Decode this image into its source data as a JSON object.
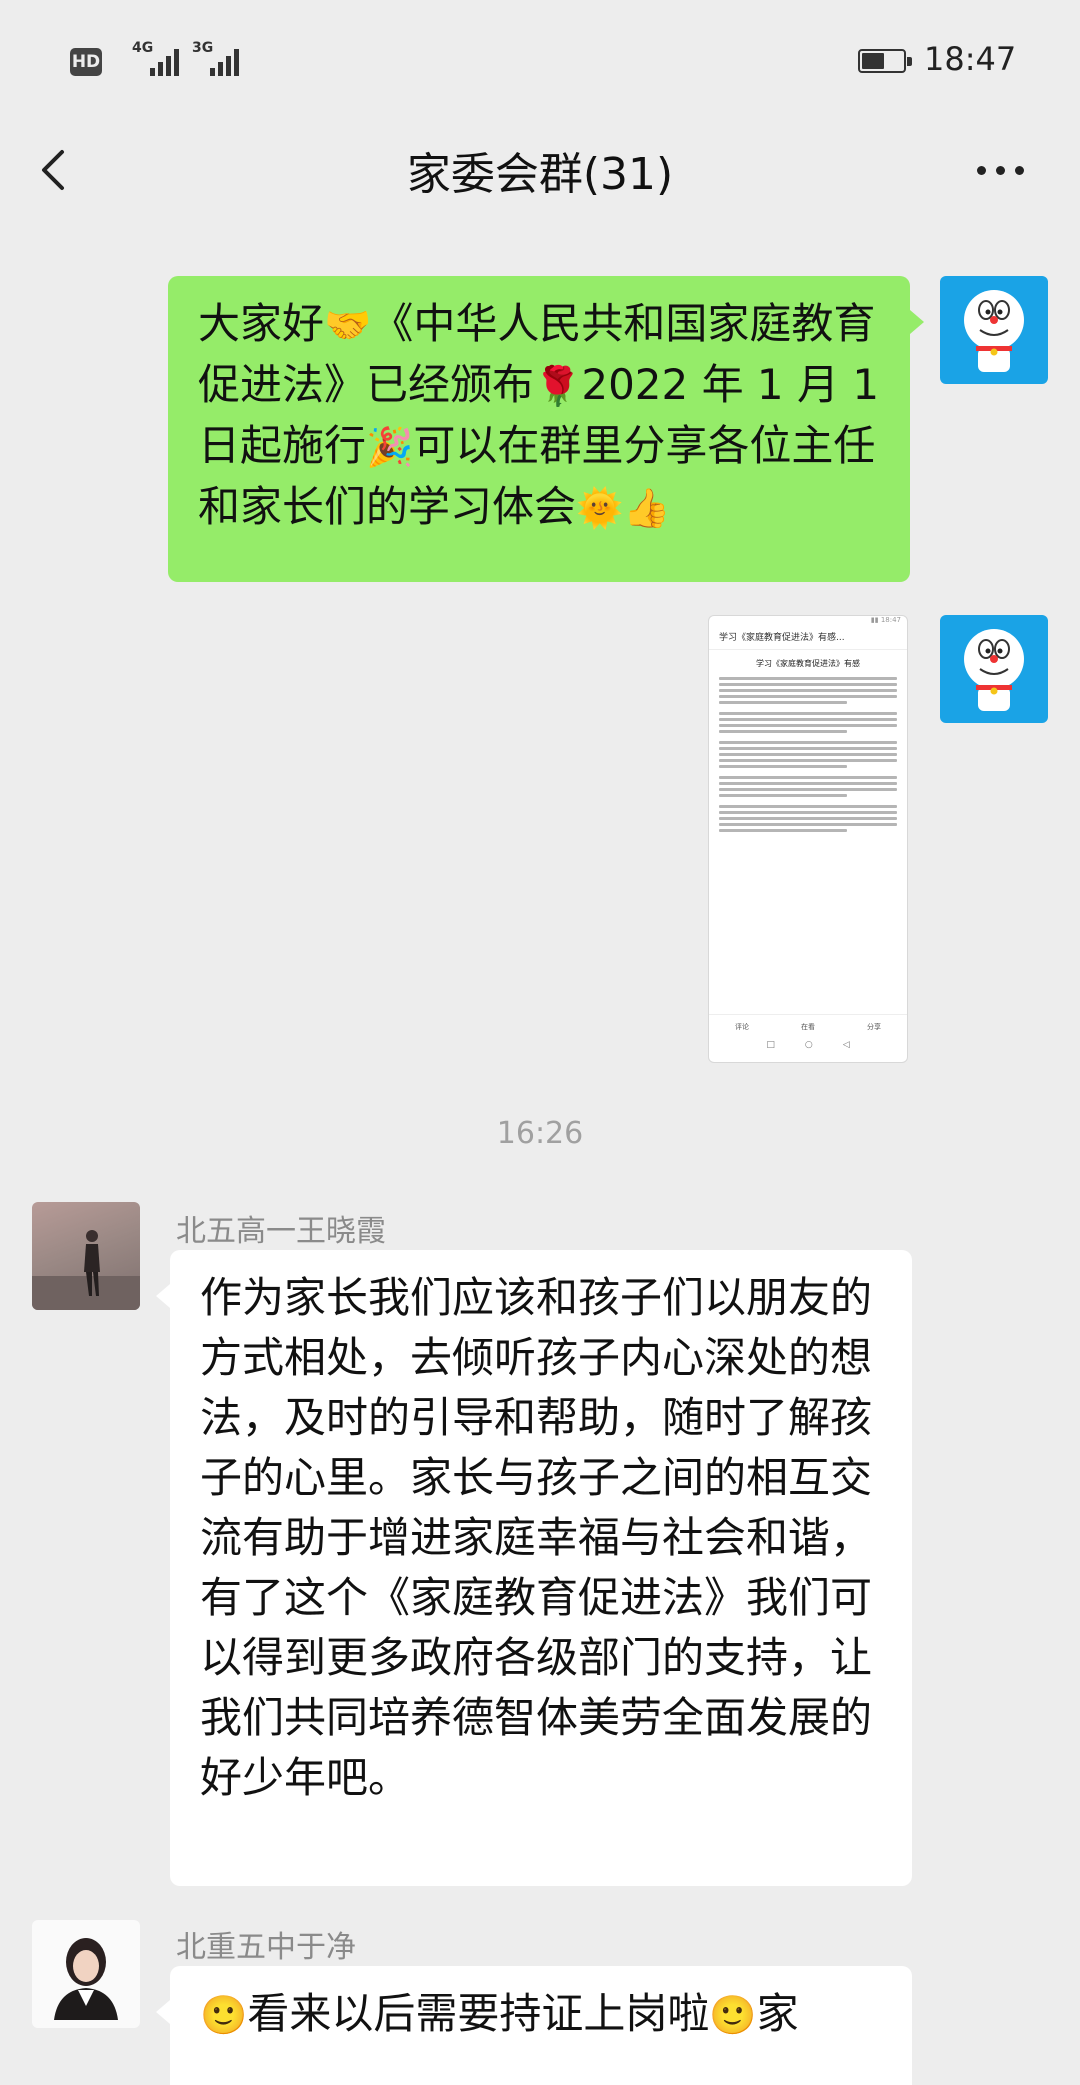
{
  "status_bar": {
    "hd_label": "HD",
    "signal_1": "4G",
    "signal_2": "3G",
    "time": "18:47"
  },
  "header": {
    "title": "家委会群(31)",
    "back_icon": "chevron-left-icon",
    "more_icon": "more-dots-icon"
  },
  "messages": [
    {
      "type": "text",
      "side": "right",
      "parts": [
        "大家好",
        "🤝",
        "《中华人民共和国家庭教育促进法》已经颁布",
        "🌹",
        "2022 年 1 月 1 日起施行",
        "🎉",
        "可以在群里分享各位主任和家长们的学习体会",
        "🌞",
        "👍"
      ]
    },
    {
      "type": "image",
      "side": "right",
      "caption_header": "学习《家庭教育促进法》有感...",
      "caption_title": "学习《家庭教育促进法》有感",
      "footer_items": [
        "评论",
        "在看",
        "分享"
      ]
    },
    {
      "type": "time",
      "text": "16:26"
    },
    {
      "type": "text",
      "side": "left",
      "sender": "北五高一王晓霞",
      "text": "作为家长我们应该和孩子们以朋友的方式相处，去倾听孩子内心深处的想法，及时的引导和帮助，随时了解孩子的心里。家长与孩子之间的相互交流有助于增进家庭幸福与社会和谐，有了这个《家庭教育促进法》我们可以得到更多政府各级部门的支持，让我们共同培养德智体美劳全面发展的好少年吧。"
    },
    {
      "type": "text",
      "side": "left",
      "sender": "北重五中于净",
      "parts": [
        "🙂",
        "看来以后需要持证上岗啦",
        "🙂",
        "家"
      ]
    }
  ],
  "colors": {
    "background": "#ededed",
    "bubble_self": "#95ec69",
    "bubble_other": "#ffffff",
    "avatar_blue": "#1aa3e6"
  }
}
